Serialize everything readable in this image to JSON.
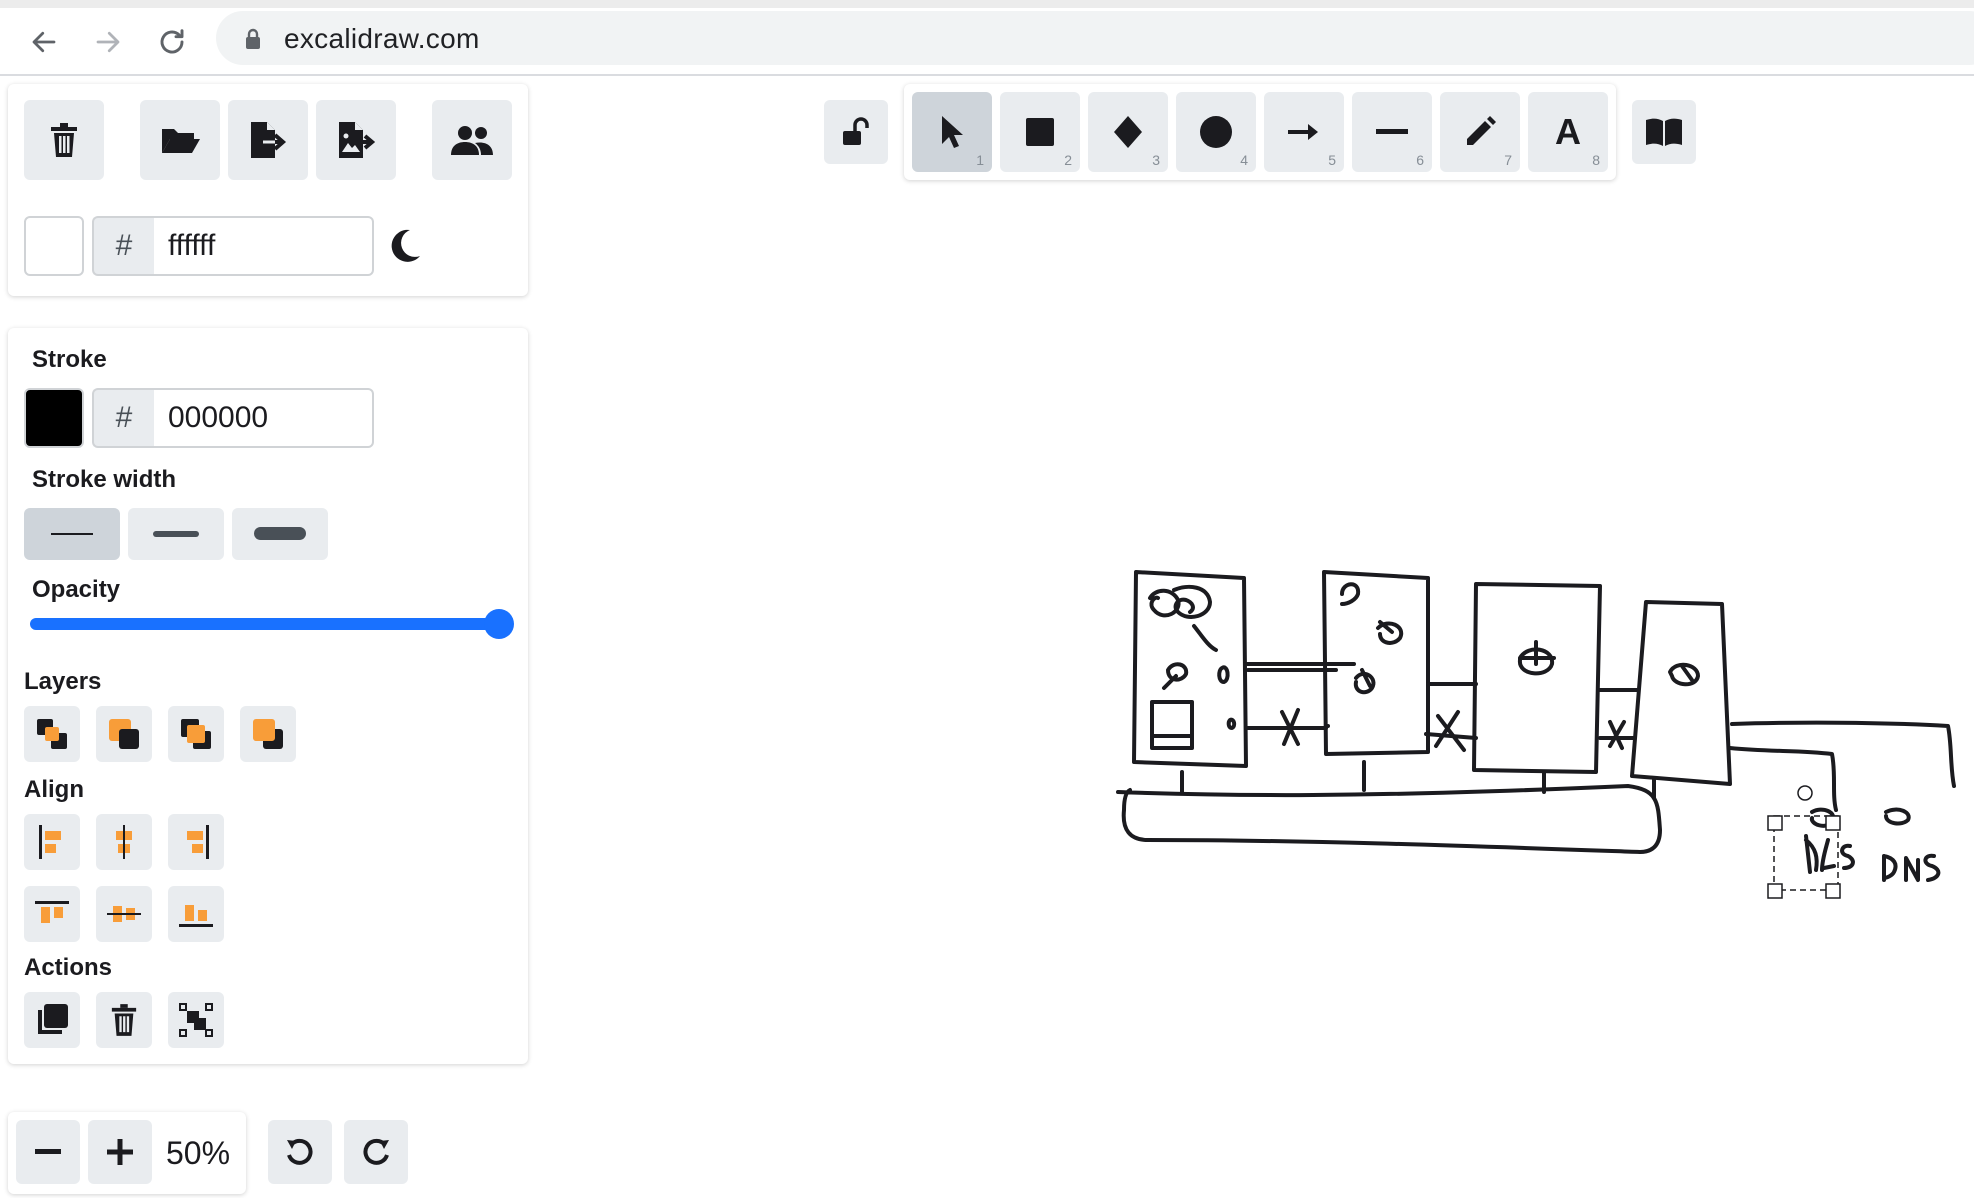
{
  "browser": {
    "url": "excalidraw.com"
  },
  "canvas": {
    "background_label": "#",
    "background_value": "ffffff",
    "background_color": "#ffffff"
  },
  "toolbar": {
    "tools": [
      {
        "name": "selection",
        "icon": "cursor-icon",
        "number": "1",
        "active": true
      },
      {
        "name": "rectangle",
        "icon": "square-icon",
        "number": "2"
      },
      {
        "name": "diamond",
        "icon": "diamond-icon",
        "number": "3"
      },
      {
        "name": "ellipse",
        "icon": "circle-icon",
        "number": "4"
      },
      {
        "name": "arrow",
        "icon": "arrow-icon",
        "number": "5"
      },
      {
        "name": "line",
        "icon": "line-icon",
        "number": "6"
      },
      {
        "name": "draw",
        "icon": "pencil-icon",
        "number": "7"
      },
      {
        "name": "text",
        "icon": "text-icon",
        "number": "8"
      }
    ],
    "text_tool_glyph": "A"
  },
  "properties": {
    "stroke_label": "Stroke",
    "stroke_hash": "#",
    "stroke_value": "000000",
    "stroke_color": "#000000",
    "stroke_width_label": "Stroke width",
    "opacity_label": "Opacity",
    "opacity_value": 100,
    "layers_label": "Layers",
    "align_label": "Align",
    "actions_label": "Actions"
  },
  "zoom": {
    "value": "50%"
  },
  "colors": {
    "accent": "#1971ff",
    "button_bg": "#e9ecef",
    "active_bg": "#ced4da",
    "orange": "#f89d39"
  }
}
